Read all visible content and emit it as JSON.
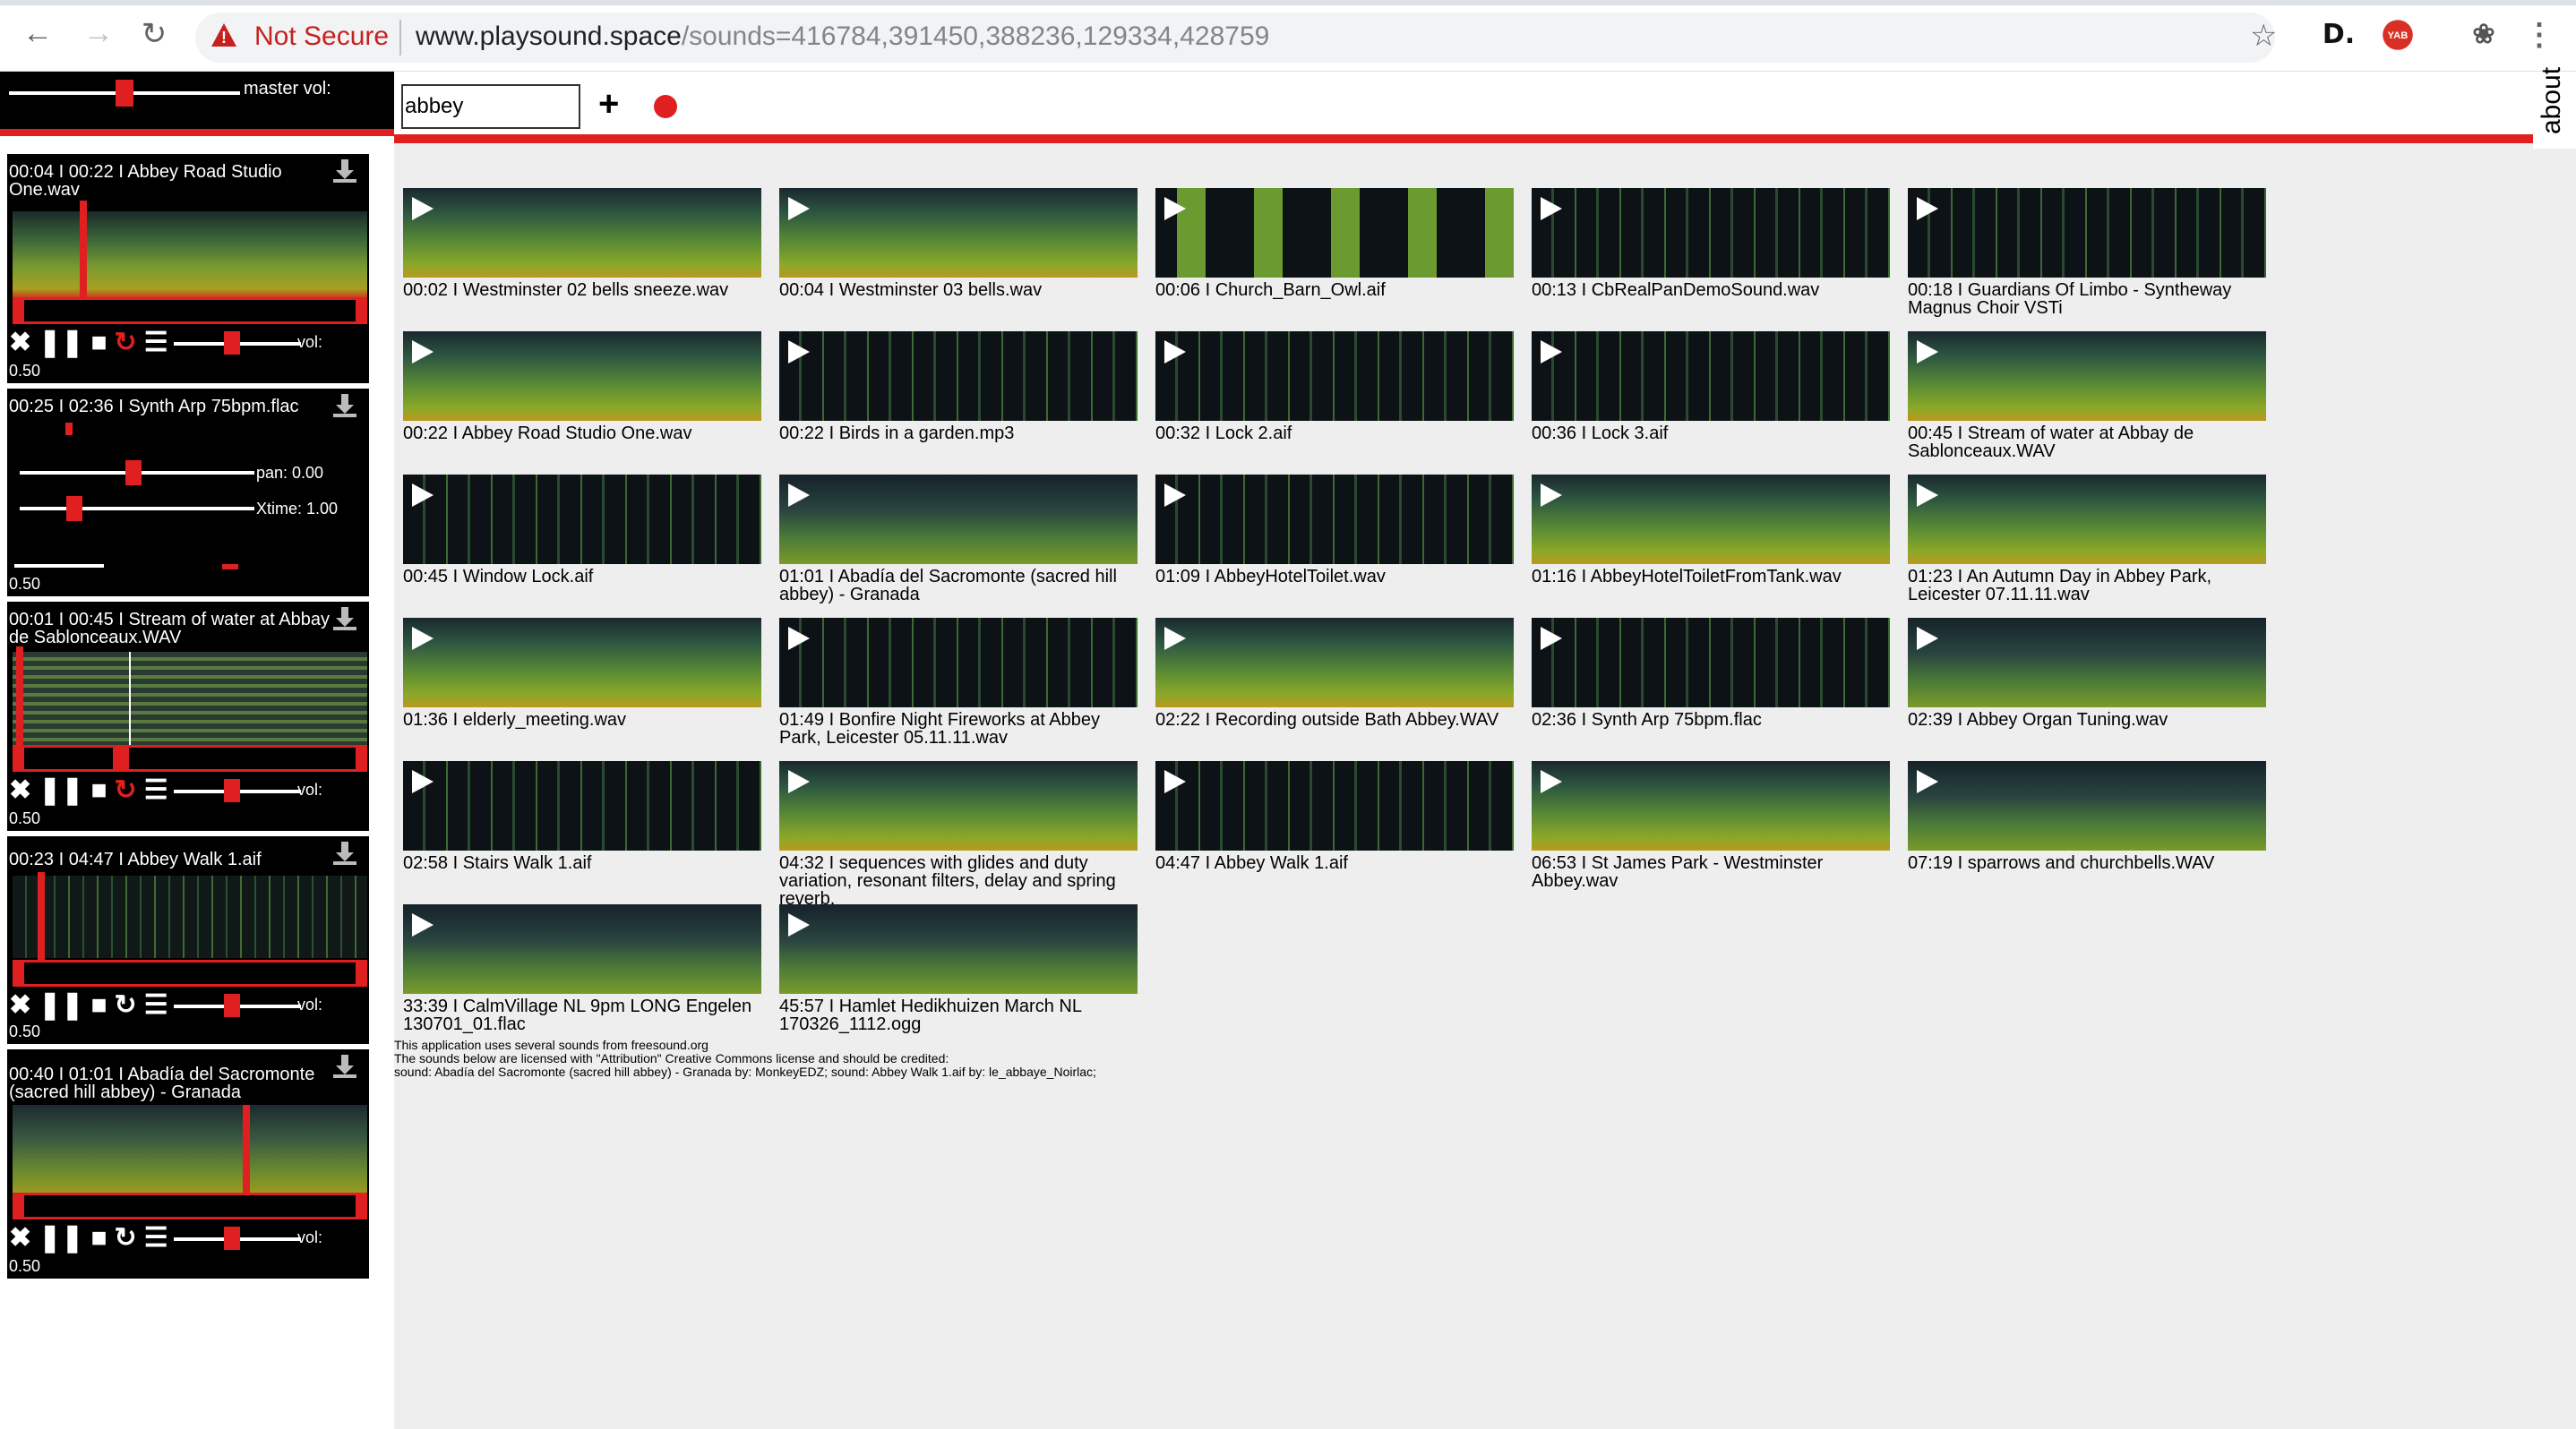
{
  "browser": {
    "not_secure": "Not Secure",
    "url_host": "www.playsound.space",
    "url_query": "/sounds=416784,391450,388236,129334,428759",
    "ext_d": "D.",
    "ext_yab": "YAB"
  },
  "master": {
    "label": "master vol:",
    "value": 0.5
  },
  "players": [
    {
      "title": "00:04 I 00:22 I Abbey Road Studio One.wav",
      "vol_label": "vol:",
      "rate": "0.50",
      "position": 0.2
    },
    {
      "title": "00:25 I 02:36 I Synth Arp 75bpm.flac",
      "pan_label": "pan: 0.00",
      "xtime_label": "Xtime: 1.00",
      "rate": "0.50",
      "position": 0.16
    },
    {
      "title": "00:01 I 00:45 I Stream of water at Abbay de Sablonceaux.WAV",
      "vol_label": "vol:",
      "rate": "0.50",
      "position": 0.02
    },
    {
      "title": "00:23 I 04:47 I Abbey Walk 1.aif",
      "vol_label": "vol:",
      "rate": "0.50",
      "position": 0.08
    },
    {
      "title": "00:40 I 01:01 I Abadía del Sacromonte (sacred hill abbey) - Granada",
      "vol_label": "vol:",
      "rate": "0.50",
      "position": 0.66
    }
  ],
  "search": {
    "value": "abbey",
    "add_label": "+"
  },
  "about": "about",
  "results": [
    {
      "label": "00:02 I Westminster 02 bells sneeze.wav",
      "style": "green"
    },
    {
      "label": "00:04 I Westminster 03 bells.wav",
      "style": "green"
    },
    {
      "label": "00:06 I Church_Barn_Owl.aif",
      "style": "bands"
    },
    {
      "label": "00:13 I CbRealPanDemoSound.wav",
      "style": "dark"
    },
    {
      "label": "00:18 I Guardians Of Limbo - Syntheway Magnus Choir VSTi",
      "style": "dark"
    },
    {
      "label": "00:22 I Abbey Road Studio One.wav",
      "style": "green"
    },
    {
      "label": "00:22 I Birds in a garden.mp3",
      "style": "dark"
    },
    {
      "label": "00:32 I Lock 2.aif",
      "style": "dark"
    },
    {
      "label": "00:36 I Lock 3.aif",
      "style": "dark"
    },
    {
      "label": "00:45 I Stream of water at Abbay de Sablonceaux.WAV",
      "style": "green"
    },
    {
      "label": "00:45 I Window Lock.aif",
      "style": "dark"
    },
    {
      "label": "01:01 I Abadía del Sacromonte (sacred hill abbey) - Granada",
      "style": "mid"
    },
    {
      "label": "01:09 I AbbeyHotelToilet.wav",
      "style": "dark"
    },
    {
      "label": "01:16 I AbbeyHotelToiletFromTank.wav",
      "style": "green"
    },
    {
      "label": "01:23 I An Autumn Day in Abbey Park, Leicester 07.11.11.wav",
      "style": "green"
    },
    {
      "label": "01:36 I elderly_meeting.wav",
      "style": "green"
    },
    {
      "label": "01:49 I Bonfire Night Fireworks at Abbey Park, Leicester 05.11.11.wav",
      "style": "dark"
    },
    {
      "label": "02:22 I Recording outside Bath Abbey.WAV",
      "style": "green"
    },
    {
      "label": "02:36 I Synth Arp 75bpm.flac",
      "style": "dark"
    },
    {
      "label": "02:39 I Abbey Organ Tuning.wav",
      "style": "mid"
    },
    {
      "label": "02:58 I Stairs Walk 1.aif",
      "style": "dark"
    },
    {
      "label": "04:32 I sequences with glides and duty variation, resonant filters, delay and spring reverb.",
      "style": "green"
    },
    {
      "label": "04:47 I Abbey Walk 1.aif",
      "style": "dark"
    },
    {
      "label": "06:53 I St James Park - Westminster Abbey.wav",
      "style": "green"
    },
    {
      "label": "07:19 I sparrows and churchbells.WAV",
      "style": "mid"
    },
    {
      "label": "33:39 I CalmVillage NL 9pm LONG Engelen 130701_01.flac",
      "style": "mid"
    },
    {
      "label": "45:57 I Hamlet Hedikhuizen March NL 170326_1112.ogg",
      "style": "mid"
    }
  ],
  "credits": [
    "This application uses several sounds from freesound.org",
    "The sounds below are licensed with \"Attribution\" Creative Commons license and should be credited:",
    "sound: Abadía del Sacromonte (sacred hill abbey) - Granada by: MonkeyEDZ; sound: Abbey Walk 1.aif by: le_abbaye_Noirlac;"
  ]
}
